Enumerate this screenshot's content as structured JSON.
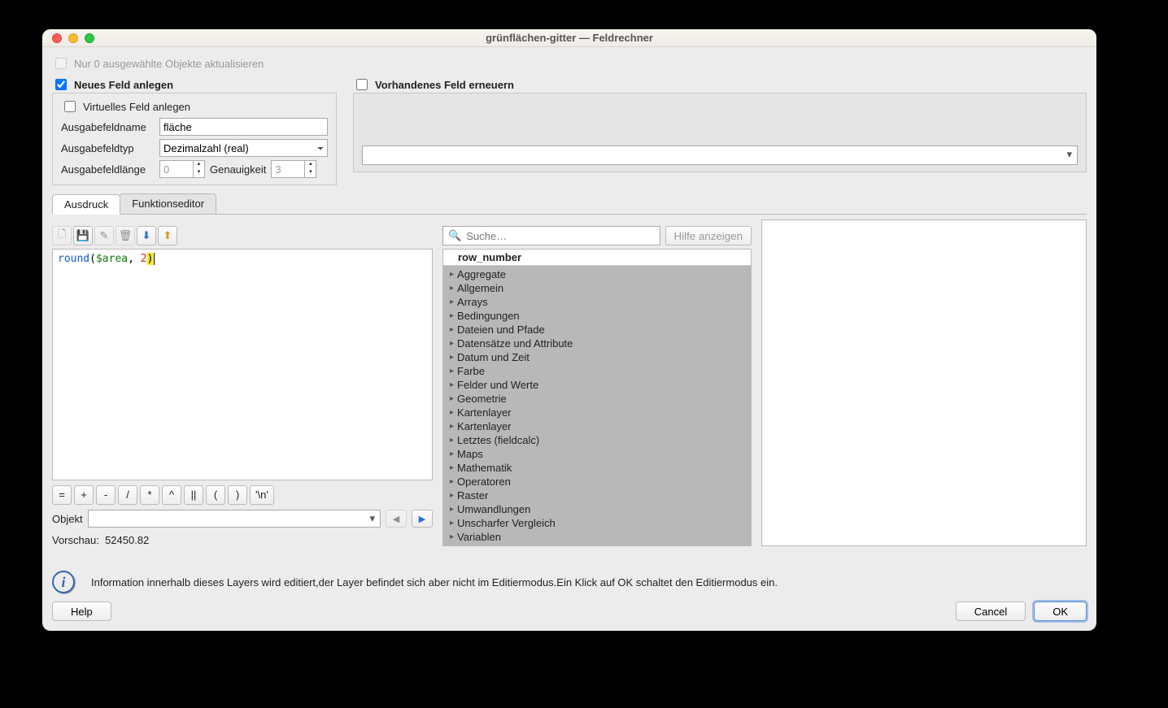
{
  "window": {
    "title": "grünflächen-gitter — Feldrechner"
  },
  "topbar": {
    "update_selected": "Nur 0 ausgewählte Objekte aktualisieren",
    "new_field": "Neues Feld anlegen",
    "update_existing": "Vorhandenes Feld erneuern"
  },
  "newfield": {
    "virtual": "Virtuelles Feld anlegen",
    "name_label": "Ausgabefeldname",
    "name_value": "fläche",
    "type_label": "Ausgabefeldtyp",
    "type_value": "Dezimalzahl (real)",
    "len_label": "Ausgabefeldlänge",
    "len_value": "0",
    "prec_label": "Genauigkeit",
    "prec_value": "3"
  },
  "tabs": {
    "expr": "Ausdruck",
    "func": "Funktionseditor"
  },
  "editor": {
    "tok_func": "round",
    "tok_lpar": "(",
    "tok_var": "$area",
    "tok_comma": ", ",
    "tok_num": "2",
    "tok_rpar": ")"
  },
  "ops": [
    "=",
    "+",
    "-",
    "/",
    "*",
    "^",
    "||",
    "(",
    ")",
    "'\\n'"
  ],
  "objekt": {
    "label": "Objekt"
  },
  "preview": {
    "label": "Vorschau:",
    "value": "52450.82"
  },
  "search": {
    "placeholder": "Suche…",
    "help": "Hilfe anzeigen"
  },
  "tree": {
    "header": "row_number",
    "items": [
      "Aggregate",
      "Allgemein",
      "Arrays",
      "Bedingungen",
      "Dateien und Pfade",
      "Datensätze und Attribute",
      "Datum und Zeit",
      "Farbe",
      "Felder und Werte",
      "Geometrie",
      "Kartenlayer",
      "Kartenlayer",
      "Letztes (fieldcalc)",
      "Maps",
      "Mathematik",
      "Operatoren",
      "Raster",
      "Umwandlungen",
      "Unscharfer Vergleich",
      "Variablen"
    ]
  },
  "info": "Information innerhalb dieses Layers wird editiert,der Layer befindet sich aber nicht im Editiermodus.Ein Klick auf OK schaltet den Editiermodus ein.",
  "buttons": {
    "help": "Help",
    "cancel": "Cancel",
    "ok": "OK"
  }
}
